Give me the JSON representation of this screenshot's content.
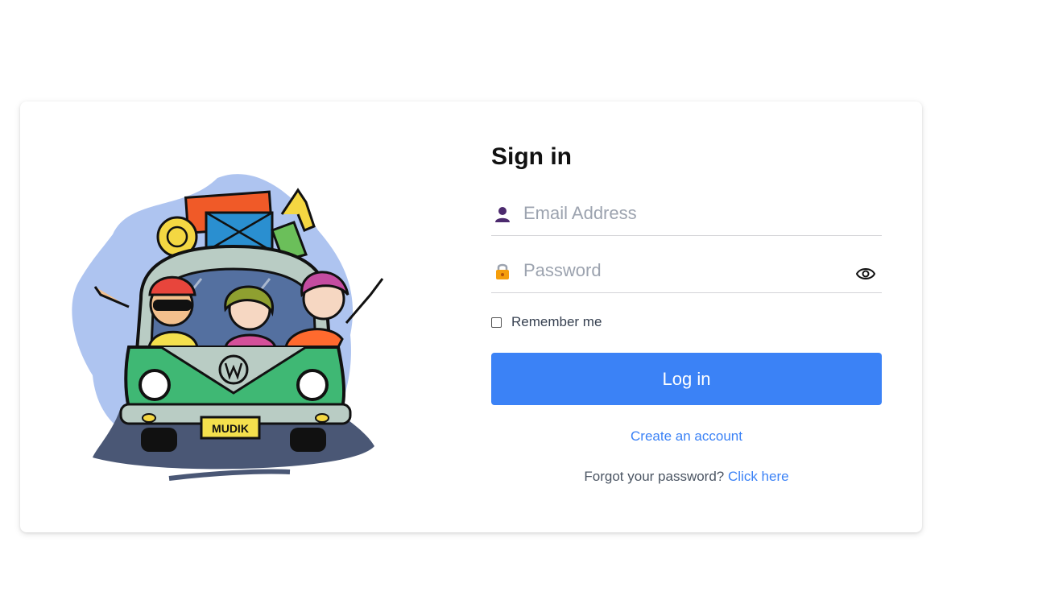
{
  "form": {
    "title": "Sign in",
    "email": {
      "placeholder": "Email Address",
      "value": ""
    },
    "password": {
      "placeholder": "Password",
      "value": ""
    },
    "remember_label": "Remember me",
    "remember_checked": false,
    "login_label": "Log in",
    "create_account_label": "Create an account",
    "forgot_text": "Forgot your password?",
    "forgot_link": "Click here"
  },
  "illustration": {
    "plate_text": "MUDIK"
  },
  "icons": {
    "email": "user-icon",
    "password": "lock-icon",
    "toggle": "eye-icon"
  },
  "colors": {
    "accent": "#3b82f6",
    "blob": "#aec4f0",
    "bus_green": "#3fb874",
    "shadow": "#4a5775"
  }
}
